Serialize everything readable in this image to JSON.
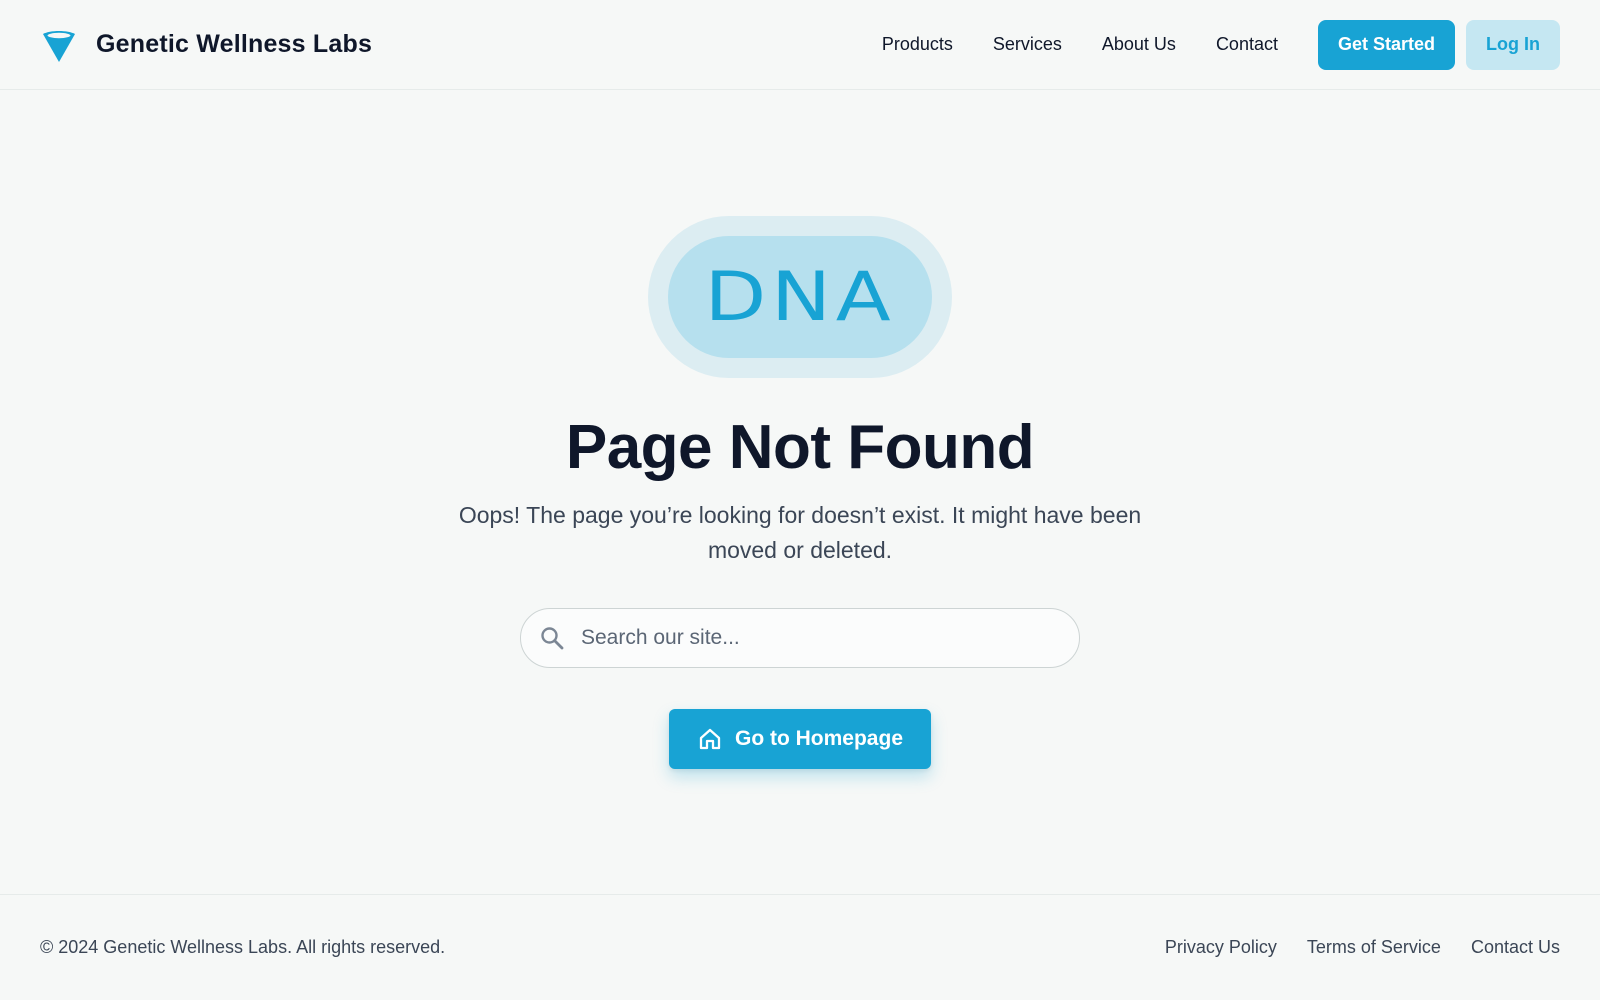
{
  "header": {
    "brand_name": "Genetic Wellness Labs",
    "nav": [
      "Products",
      "Services",
      "About Us",
      "Contact"
    ],
    "get_started_label": "Get Started",
    "login_label": "Log In"
  },
  "main": {
    "badge_text": "DNA",
    "title": "Page Not Found",
    "subtitle": "Oops! The page you’re looking for doesn’t exist. It might have been moved or deleted.",
    "search": {
      "placeholder": "Search our site...",
      "value": ""
    },
    "home_button_label": "Go to Homepage"
  },
  "footer": {
    "copyright": "© 2024 Genetic Wellness Labs. All rights reserved.",
    "links": [
      "Privacy Policy",
      "Terms of Service",
      "Contact Us"
    ]
  },
  "icons": {
    "brand": "funnel-logo-icon",
    "search": "search-icon",
    "home": "home-icon"
  },
  "colors": {
    "accent": "#18a3d4",
    "accent_light": "#c5e7f2",
    "background": "#f6f8f7",
    "text_dark": "#0f172a",
    "text_muted": "#3b4656"
  }
}
